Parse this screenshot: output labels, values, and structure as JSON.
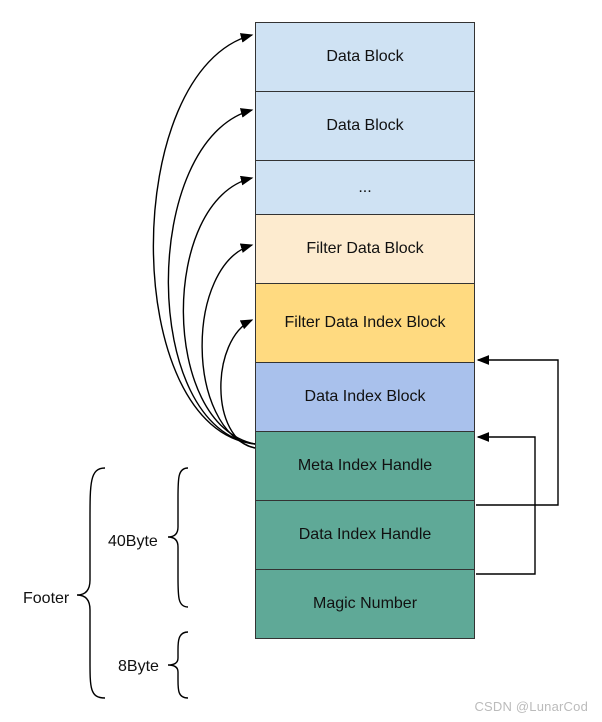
{
  "blocks": {
    "data1": "Data Block",
    "data2": "Data Block",
    "ellipsis": "...",
    "filter_data": "Filter Data Block",
    "filter_index": "Filter Data Index Block",
    "data_index": "Data Index Block",
    "meta_handle": "Meta Index Handle",
    "data_handle": "Data Index Handle",
    "magic": "Magic Number"
  },
  "labels": {
    "size_40": "40Byte",
    "footer": "Footer",
    "size_8": "8Byte"
  },
  "watermark": "CSDN @LunarCod"
}
